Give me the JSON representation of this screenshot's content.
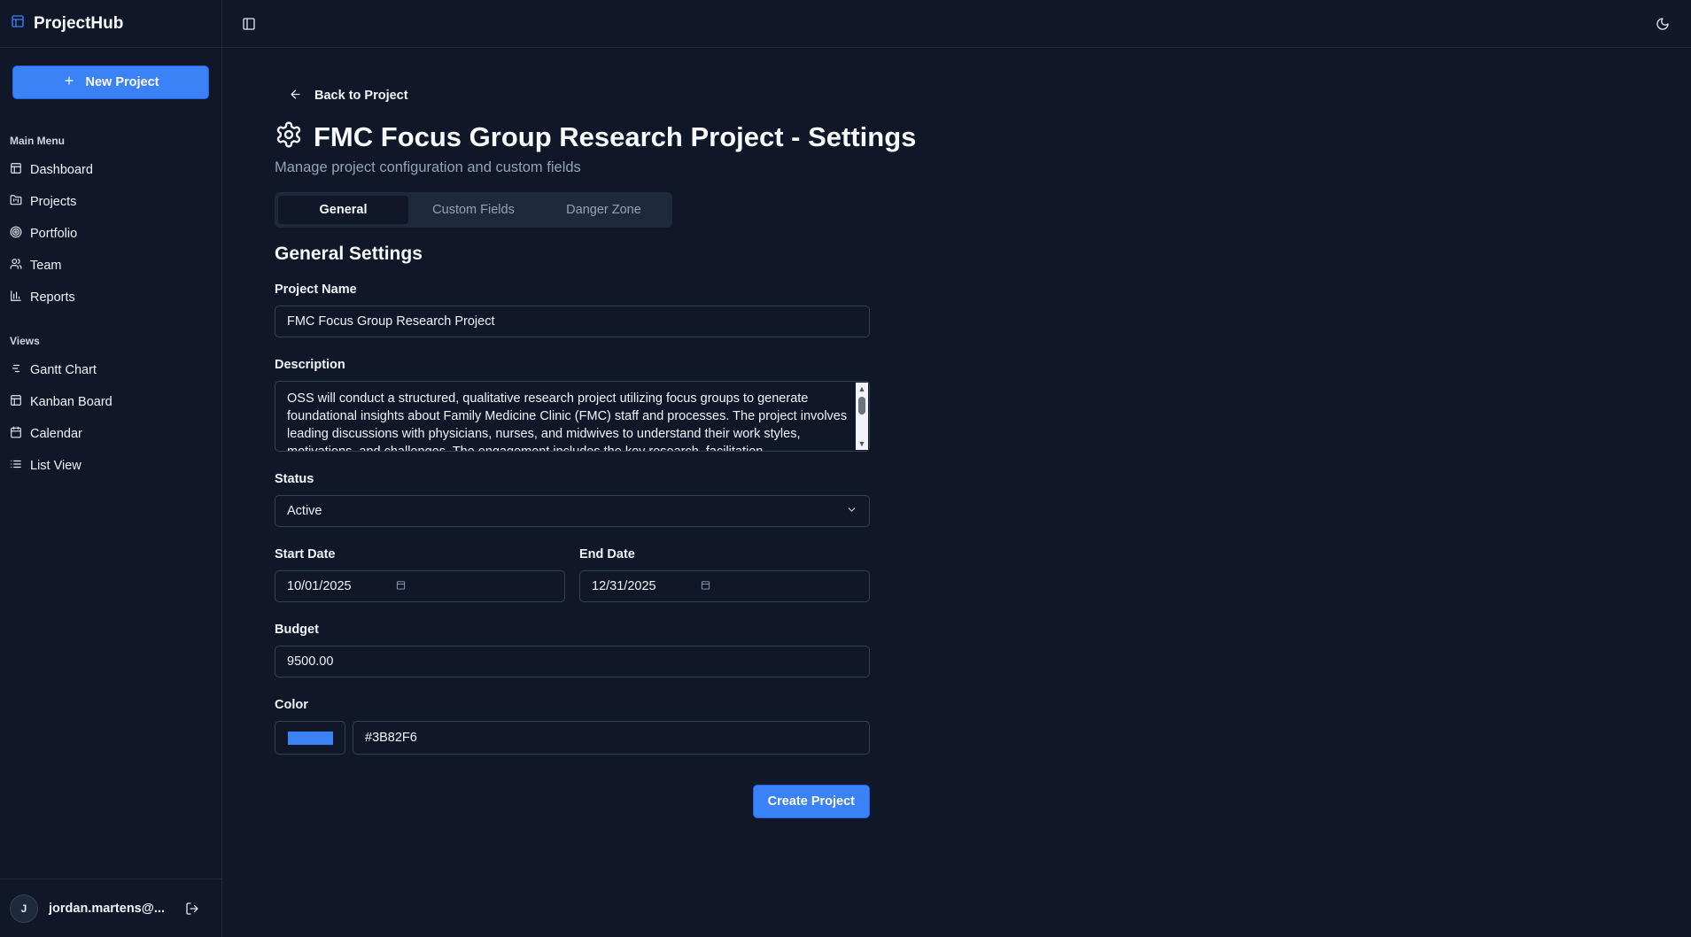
{
  "app": {
    "name": "ProjectHub",
    "accent": "#3b82f6"
  },
  "sidebar": {
    "new_project_label": "New Project",
    "main_menu_label": "Main Menu",
    "main_menu": [
      {
        "label": "Dashboard",
        "icon": "layout-dashboard-icon"
      },
      {
        "label": "Projects",
        "icon": "folder-icon"
      },
      {
        "label": "Portfolio",
        "icon": "target-icon"
      },
      {
        "label": "Team",
        "icon": "users-icon"
      },
      {
        "label": "Reports",
        "icon": "bar-chart-icon"
      }
    ],
    "views_label": "Views",
    "views": [
      {
        "label": "Gantt Chart",
        "icon": "gantt-icon"
      },
      {
        "label": "Kanban Board",
        "icon": "kanban-icon"
      },
      {
        "label": "Calendar",
        "icon": "calendar-icon"
      },
      {
        "label": "List View",
        "icon": "list-icon"
      }
    ],
    "user": {
      "initial": "J",
      "email": "jordan.martens@..."
    }
  },
  "page": {
    "back_label": "Back to Project",
    "title": "FMC Focus Group Research Project - Settings",
    "subtitle": "Manage project configuration and custom fields",
    "tabs": [
      {
        "label": "General",
        "active": true
      },
      {
        "label": "Custom Fields",
        "active": false
      },
      {
        "label": "Danger Zone",
        "active": false
      }
    ],
    "section_title": "General Settings"
  },
  "form": {
    "project_name_label": "Project Name",
    "project_name": "FMC Focus Group Research Project",
    "description_label": "Description",
    "description": "OSS will conduct a structured, qualitative research project utilizing focus groups to generate foundational insights about Family Medicine Clinic (FMC) staff and processes. The project involves leading discussions with physicians, nurses, and midwives to understand their work styles, motivations, and challenges. The engagement includes the key research, facilitation,",
    "status_label": "Status",
    "status": "Active",
    "start_date_label": "Start Date",
    "start_date": "10/01/2025",
    "end_date_label": "End Date",
    "end_date": "12/31/2025",
    "budget_label": "Budget",
    "budget": "9500.00",
    "color_label": "Color",
    "color": "#3B82F6",
    "submit_label": "Create Project"
  }
}
